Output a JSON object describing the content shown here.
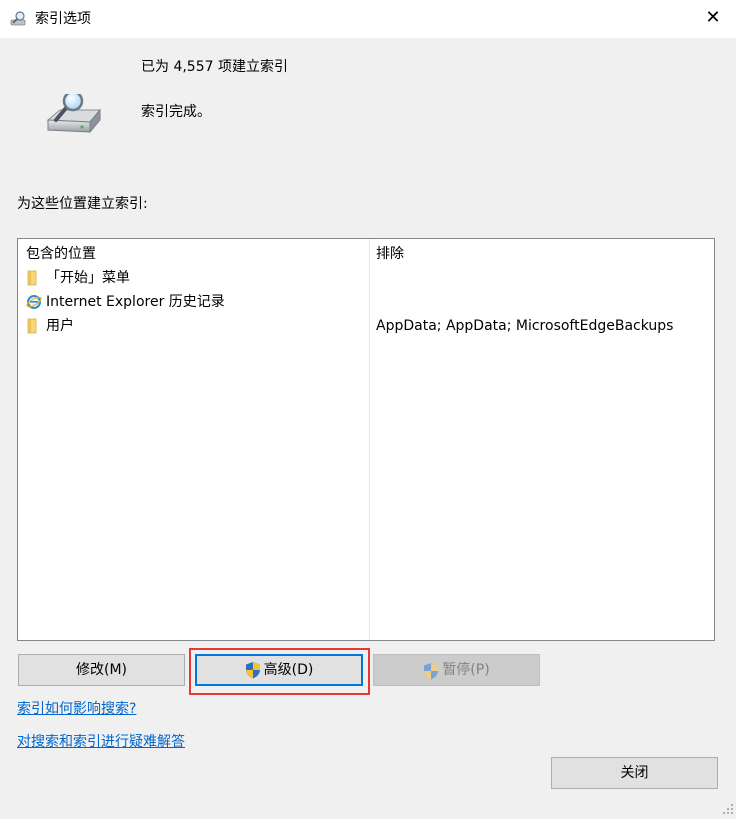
{
  "window": {
    "title": "索引选项",
    "title_icon": "indexing-options-icon",
    "close_glyph": "✕"
  },
  "status": {
    "indexed_count": "已为 4,557 项建立索引",
    "state": "索引完成。",
    "icon": "drive-magnifier-icon"
  },
  "locations": {
    "section_label": "为这些位置建立索引:",
    "columns": [
      "包含的位置",
      "排除"
    ],
    "rows": [
      {
        "icon": "folder-icon",
        "location": "「开始」菜单",
        "exclude": ""
      },
      {
        "icon": "internet-explorer-icon",
        "location": "Internet Explorer 历史记录",
        "exclude": ""
      },
      {
        "icon": "folder-icon",
        "location": "用户",
        "exclude": "AppData; AppData; MicrosoftEdgeBackups"
      }
    ]
  },
  "buttons": {
    "modify": "修改(M)",
    "advanced": "高级(D)",
    "pause": "暂停(P)",
    "close": "关闭"
  },
  "links": {
    "how_indexing_affects": "索引如何影响搜索?",
    "troubleshoot": "对搜索和索引进行疑难解答"
  },
  "colors": {
    "link": "#0066cc",
    "focus": "#0078d7",
    "highlight": "#e53935",
    "background": "#f0f0f0"
  }
}
